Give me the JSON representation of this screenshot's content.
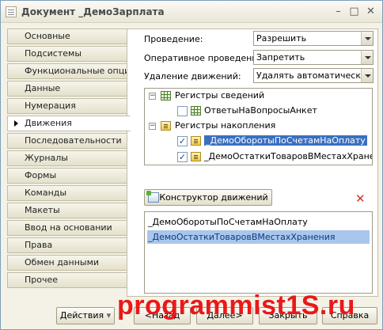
{
  "window": {
    "title": "Документ _ДемоЗарплата",
    "minimize_glyph": "–",
    "maximize_glyph": "□",
    "close_glyph": "✕"
  },
  "sidebar": {
    "items": [
      {
        "label": "Основные"
      },
      {
        "label": "Подсистемы"
      },
      {
        "label": "Функциональные опции"
      },
      {
        "label": "Данные"
      },
      {
        "label": "Нумерация"
      },
      {
        "label": "Движения",
        "active": true
      },
      {
        "label": "Последовательности"
      },
      {
        "label": "Журналы"
      },
      {
        "label": "Формы"
      },
      {
        "label": "Команды"
      },
      {
        "label": "Макеты"
      },
      {
        "label": "Ввод на основании"
      },
      {
        "label": "Права"
      },
      {
        "label": "Обмен данными"
      },
      {
        "label": "Прочее"
      }
    ]
  },
  "form": {
    "posting": {
      "label": "Проведение:",
      "value": "Разрешить"
    },
    "realtime_posting": {
      "label": "Оперативное проведение:",
      "value": "Запретить"
    },
    "register_records_deletion": {
      "label": "Удаление движений:",
      "value": "Удалять автоматически"
    }
  },
  "tree": {
    "info_group": {
      "label": "Регистры сведений",
      "expander": "−"
    },
    "info_item": {
      "label": "ОтветыНаВопросыАнкет",
      "checked": false
    },
    "accum_group": {
      "label": "Регистры накопления",
      "expander": "−"
    },
    "accum_item_1": {
      "label": "_ДемоОборотыПоСчетамНаОплату",
      "checked": true,
      "check_glyph": "✓"
    },
    "accum_item_2": {
      "label": "_ДемоОстаткиТоваровВМестахХранения",
      "checked": true,
      "check_glyph": "✓"
    }
  },
  "constructor_button": {
    "label": "Конструктор движений"
  },
  "clear_icon_glyph": "✕",
  "records_list": {
    "items": [
      {
        "label": "_ДемоОборотыПоСчетамНаОплату"
      },
      {
        "label": "_ДемоОстаткиТоваровВМестахХранения",
        "selected": true
      }
    ]
  },
  "footer": {
    "actions_label": "Действия",
    "actions_arrow": "▾",
    "back_label": "<Назад",
    "next_label": "Далее>",
    "close_label": "Закрыть",
    "help_label": "Справка"
  },
  "watermark": {
    "text": "programmist1S.ru",
    "color": "#ea1818"
  },
  "colors": {
    "selection": "#3b6fc0",
    "list_selection": "#a9c6ec",
    "window_bg": "#f4f2e7"
  }
}
